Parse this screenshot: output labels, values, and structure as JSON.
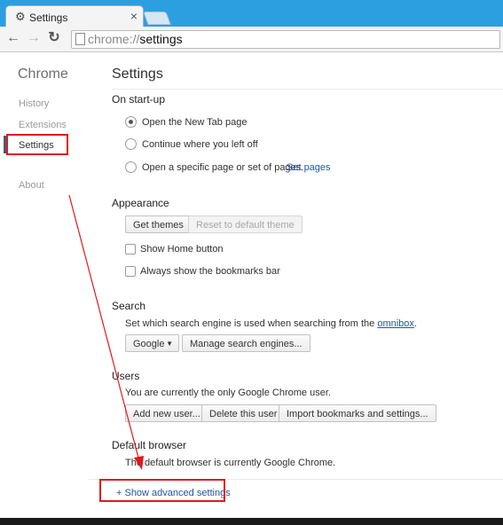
{
  "window": {
    "tab_title": "Settings",
    "tab_icon": "gear-icon",
    "close_glyph": "×",
    "url_scheme": "chrome://",
    "url_path": "settings"
  },
  "sidebar": {
    "heading": "Chrome",
    "items": [
      {
        "label": "History"
      },
      {
        "label": "Extensions"
      },
      {
        "label": "Settings"
      },
      {
        "label": "About"
      }
    ]
  },
  "main": {
    "title": "Settings",
    "startup": {
      "title": "On start-up",
      "options": [
        {
          "label": "Open the New Tab page",
          "checked": true
        },
        {
          "label": "Continue where you left off",
          "checked": false
        },
        {
          "label": "Open a specific page or set of pages.",
          "checked": false
        }
      ],
      "set_pages_link": "Set pages"
    },
    "appearance": {
      "title": "Appearance",
      "get_themes": "Get themes",
      "reset_theme": "Reset to default theme",
      "show_home": "Show Home button",
      "show_bookmarks": "Always show the bookmarks bar"
    },
    "search": {
      "title": "Search",
      "desc_prefix": "Set which search engine is used when searching from the",
      "omnibox_link": "omnibox",
      "desc_suffix": ".",
      "engine": "Google",
      "manage": "Manage search engines..."
    },
    "users": {
      "title": "Users",
      "desc": "You are currently the only Google Chrome user.",
      "add": "Add new user...",
      "delete": "Delete this user",
      "import": "Import bookmarks and settings..."
    },
    "default_browser": {
      "title": "Default browser",
      "desc": "The default browser is currently Google Chrome."
    },
    "advanced_link": "+ Show advanced settings"
  },
  "colors": {
    "titlebar": "#2c9fe0",
    "annotation_red": "#e01a1a",
    "link": "#1f56a8"
  }
}
